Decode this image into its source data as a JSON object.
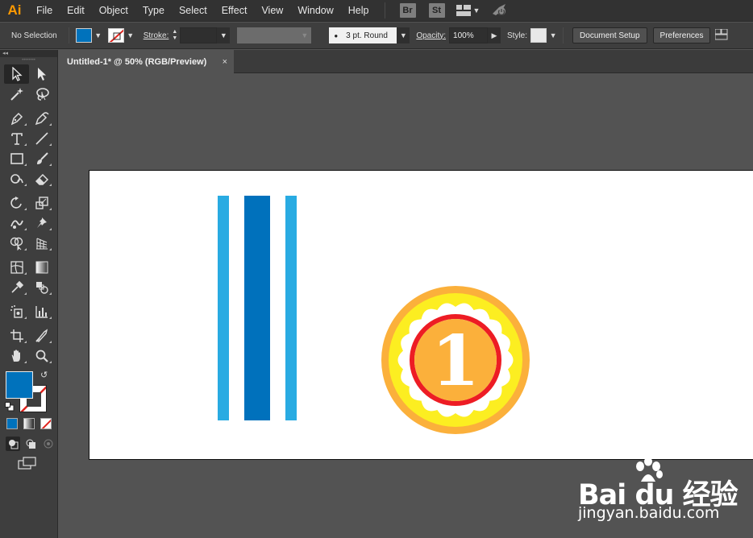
{
  "menubar": {
    "app_logo": "Ai",
    "items": [
      "File",
      "Edit",
      "Object",
      "Type",
      "Select",
      "Effect",
      "View",
      "Window",
      "Help"
    ],
    "bridge_label": "Br",
    "stock_label": "St"
  },
  "controlbar": {
    "selection_status": "No Selection",
    "stroke_label": "Stroke:",
    "brush_label": "3 pt. Round",
    "opacity_label": "Opacity:",
    "opacity_value": "100%",
    "style_label": "Style:",
    "document_setup_label": "Document Setup",
    "preferences_label": "Preferences",
    "fill_color": "#0072bc"
  },
  "toolpanel": {
    "collapse_label": "◂◂",
    "fill_color": "#0072bc"
  },
  "document": {
    "tab_title": "Untitled-1* @ 50% (RGB/Preview)",
    "close_glyph": "×"
  },
  "artwork": {
    "colors": {
      "light_blue": "#29abe2",
      "dark_blue": "#0071bc",
      "badge_outer": "#fbb03b",
      "badge_inner": "#fcee21",
      "badge_ring": "#ed1c24",
      "badge_center": "#fbb03b"
    },
    "badge_text": "1"
  },
  "watermark": {
    "word": "Bai  du 经验",
    "url": "jingyan.baidu.com"
  }
}
